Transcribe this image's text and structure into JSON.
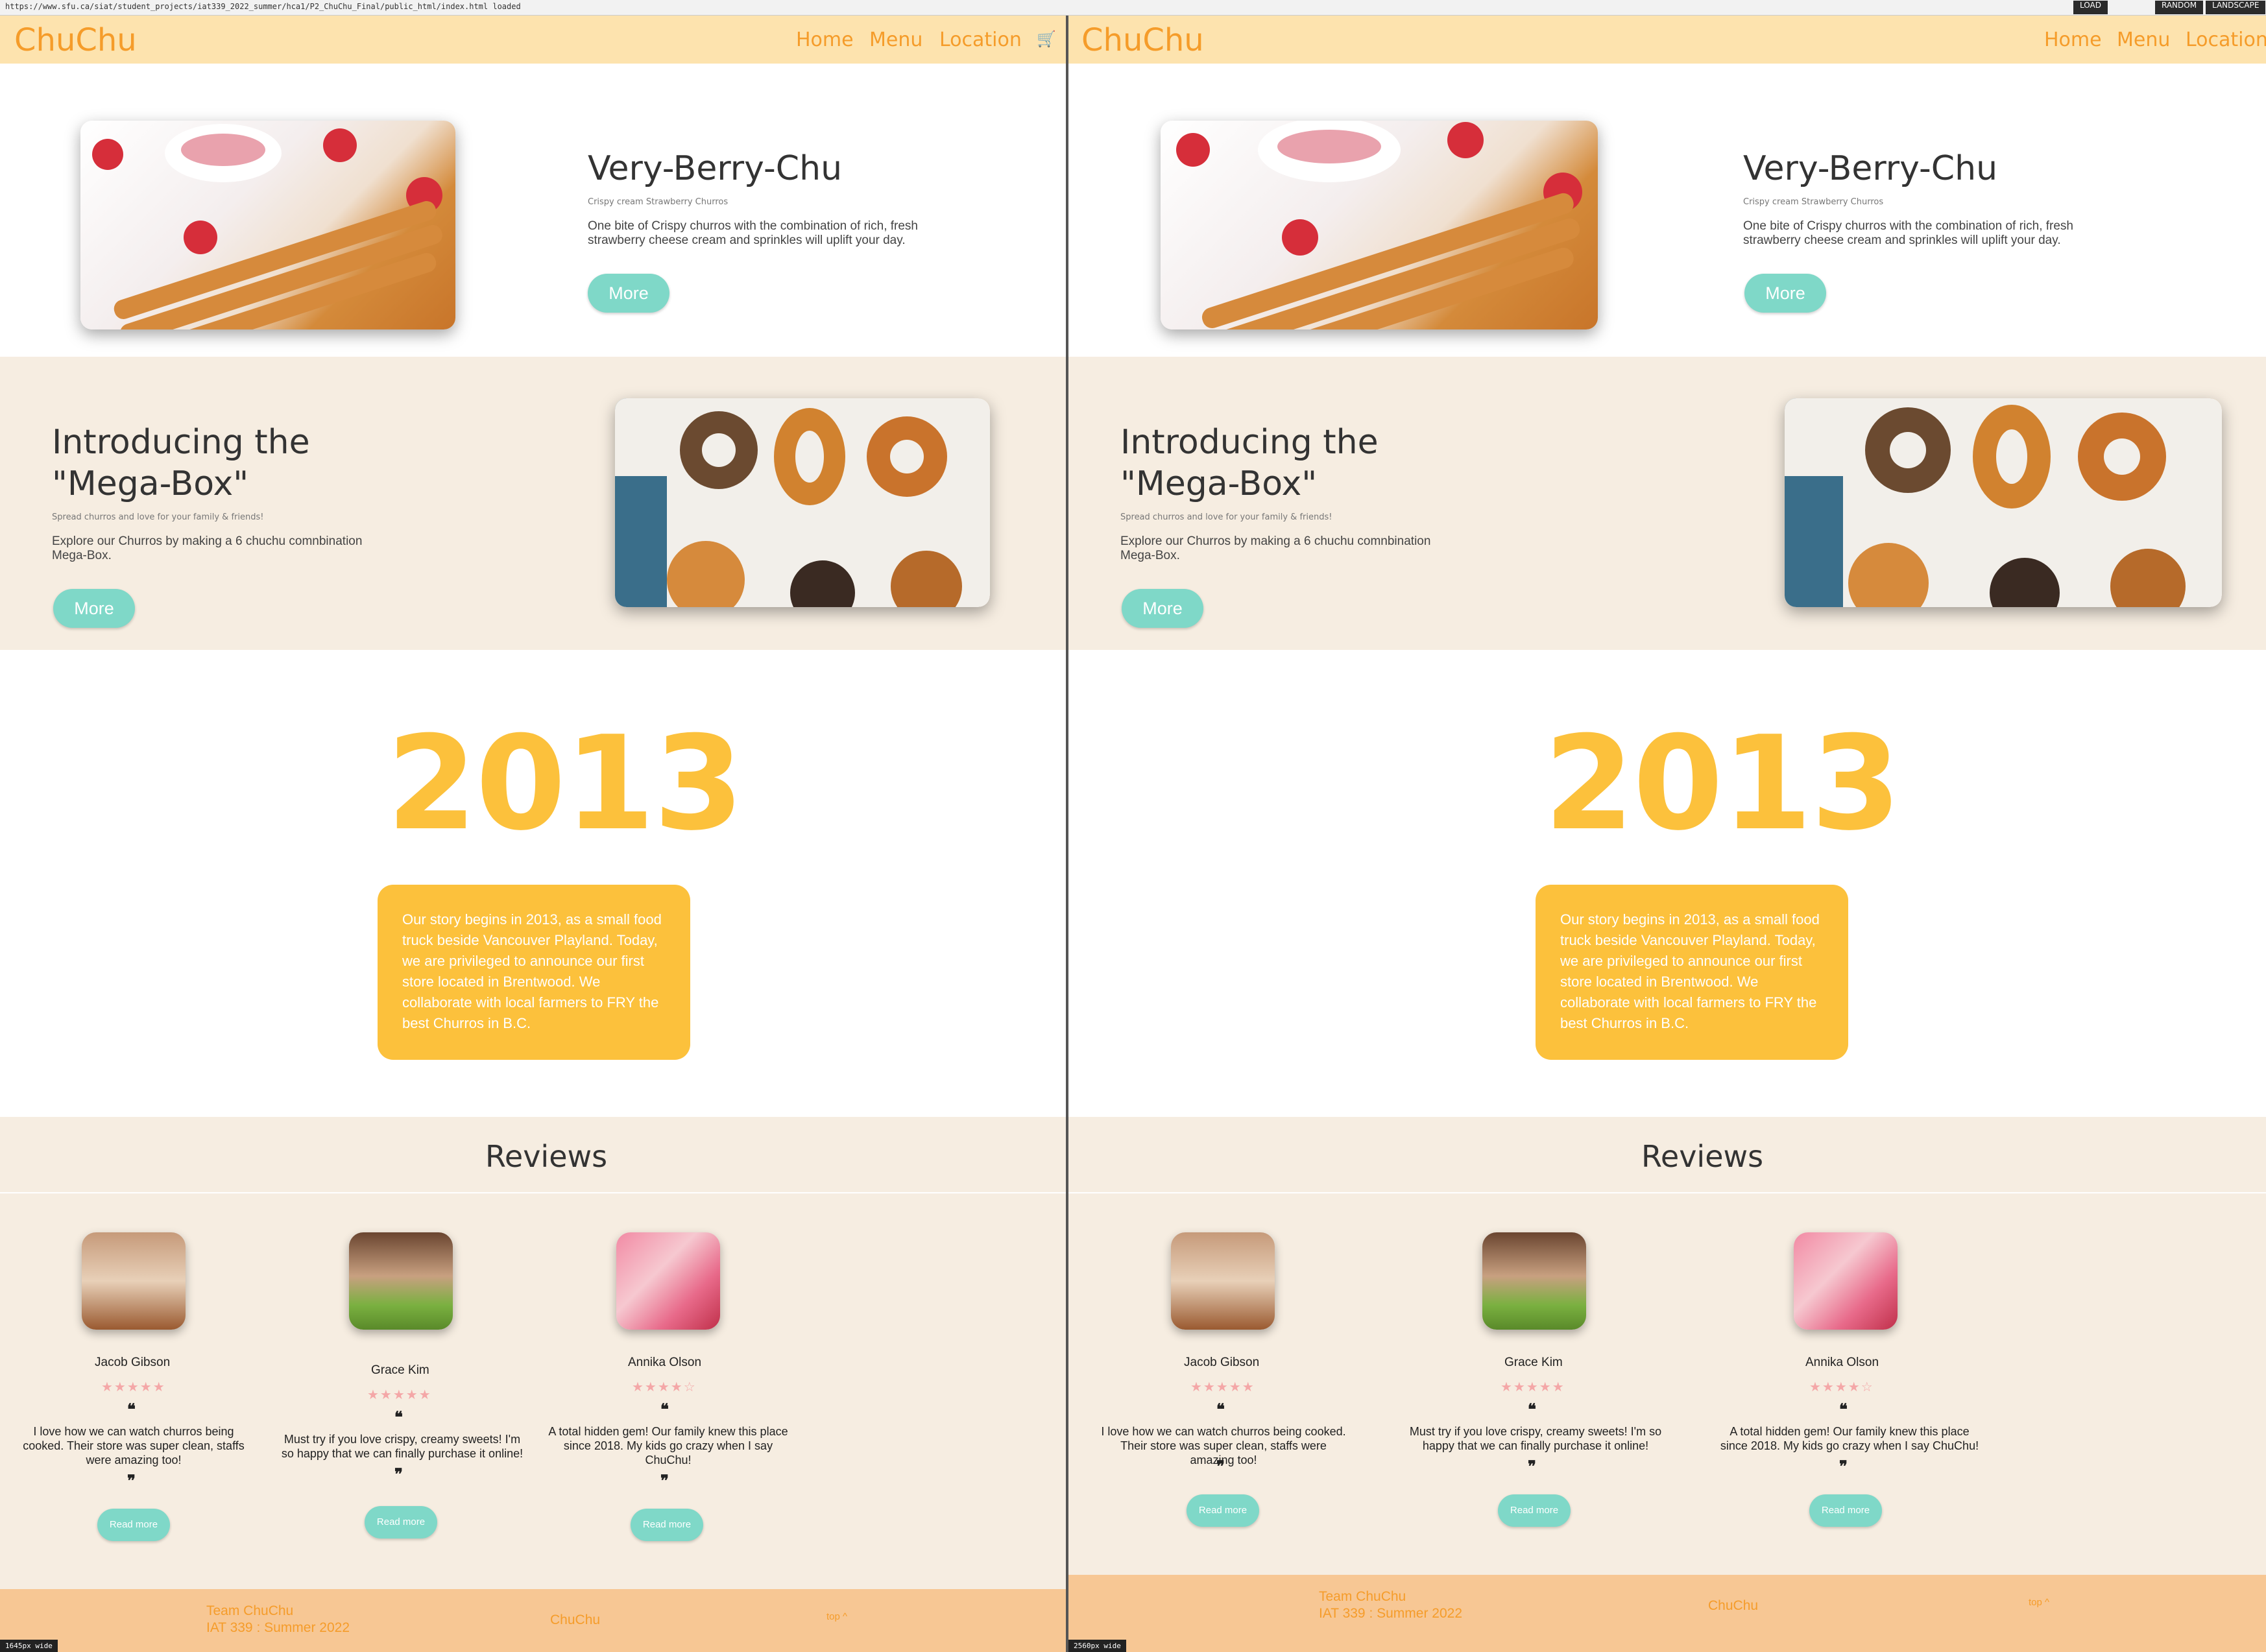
{
  "browser": {
    "status_url": "https://www.sfu.ca/siat/student_projects/iat339_2022_summer/hca1/P2_ChuChu_Final/public_html/index.html loaded",
    "load_label": "LOAD",
    "random_label": "RANDOM",
    "landscape_label": "LANDSCAPE"
  },
  "views": [
    {
      "width_label": "1645px wide"
    },
    {
      "width_label": "2560px wide"
    }
  ],
  "site": {
    "logo": "ChuChu",
    "nav": {
      "home": "Home",
      "menu": "Menu",
      "location": "Location"
    },
    "hero1": {
      "title": "Very-Berry-Chu",
      "subtitle": "Crispy cream Strawberry Churros",
      "description": "One bite of Crispy churros with the combination of rich, fresh strawberry cheese cream and sprinkles will uplift your day.",
      "button": "More"
    },
    "hero2": {
      "title_line1": "Introducing the",
      "title_line2": "\"Mega-Box\"",
      "subtitle": "Spread churros and love for your family & friends!",
      "description": "Explore our Churros by making a 6 chuchu comnbination Mega-Box.",
      "button": "More"
    },
    "story": {
      "year": "2013",
      "text": "Our story begins in 2013, as a small food truck beside Vancouver Playland. Today, we are privileged to announce our first store located in Brentwood. We collaborate with local farmers to FRY the best Churros in B.C."
    },
    "reviews": {
      "title": "Reviews",
      "items": [
        {
          "name": "Jacob Gibson",
          "rating": 4.5,
          "stars": "★★★★★",
          "text": "I love how we can watch churros being cooked. Their store was super clean, staffs were amazing too!",
          "button": "Read more"
        },
        {
          "name": "Grace Kim",
          "rating": 5,
          "stars": "★★★★★",
          "text": "Must try if you love crispy, creamy sweets! I'm so happy that we can finally purchase it online!",
          "button": "Read more"
        },
        {
          "name": "Annika Olson",
          "rating": 4,
          "stars": "★★★★☆",
          "text": "A total hidden gem! Our family knew this place since 2018. My kids go crazy when I say ChuChu!",
          "button": "Read more"
        }
      ]
    },
    "footer": {
      "team": "Team ChuChu",
      "course": "IAT 339 : Summer 2022",
      "brand": "ChuChu",
      "top": "top ^"
    },
    "colors": {
      "nav_bg": "#fde3ae",
      "accent_orange": "#f59c2a",
      "button_teal": "#7fd8c8",
      "story_yellow": "#fcc13c",
      "section_beige": "#f6ede1",
      "footer_bg": "#f7c794"
    }
  }
}
